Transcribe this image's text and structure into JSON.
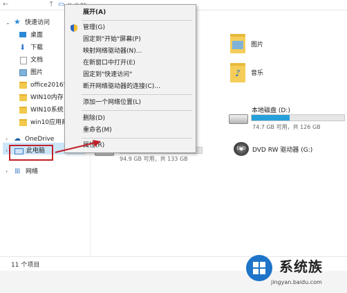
{
  "breadcrumb": {
    "location": "此电脑"
  },
  "sidebar": {
    "quick_access": "快速访问",
    "items": [
      {
        "label": "桌面"
      },
      {
        "label": "下载"
      },
      {
        "label": "文档"
      },
      {
        "label": "图片"
      },
      {
        "label": "office2016安"
      },
      {
        "label": "WIN10内存占"
      },
      {
        "label": "WIN10系统"
      },
      {
        "label": "win10应用商"
      }
    ],
    "onedrive": "OneDrive",
    "thispc": "此电脑",
    "network": "网络"
  },
  "content": {
    "folders": [
      {
        "label": "图片"
      },
      {
        "label": "音乐"
      }
    ],
    "drive_c": {
      "usage": "94.9 GB 可用，共 133 GB",
      "fill": 0.29
    },
    "drive_d": {
      "name": "本地磁盘 (D:)",
      "usage": "74.7 GB 可用，共 126 GB",
      "fill": 0.41
    },
    "drive_g": {
      "name": "DVD RW 驱动器 (G:)",
      "icon_text": "DVD"
    }
  },
  "context_menu": {
    "items": [
      {
        "label": "展开(A)",
        "bold": true
      },
      {
        "label": "管理(G)",
        "icon": "shield-icon"
      },
      {
        "label": "固定到\"开始\"屏幕(P)"
      },
      {
        "label": "映射网络驱动器(N)..."
      },
      {
        "label": "在新窗口中打开(E)"
      },
      {
        "label": "固定到\"快速访问\""
      },
      {
        "label": "断开网络驱动器的连接(C)..."
      },
      {
        "label": "添加一个网络位置(L)"
      },
      {
        "label": "删除(D)"
      },
      {
        "label": "重命名(M)"
      },
      {
        "label": "属性(R)"
      }
    ]
  },
  "status": {
    "items": "11 个项目"
  },
  "watermark": {
    "brand": "系统族",
    "url": "jingyan.baidu.com"
  },
  "colors": {
    "accent": "#26a0da",
    "highlight": "#c0202a",
    "selection": "#cce6f9"
  }
}
